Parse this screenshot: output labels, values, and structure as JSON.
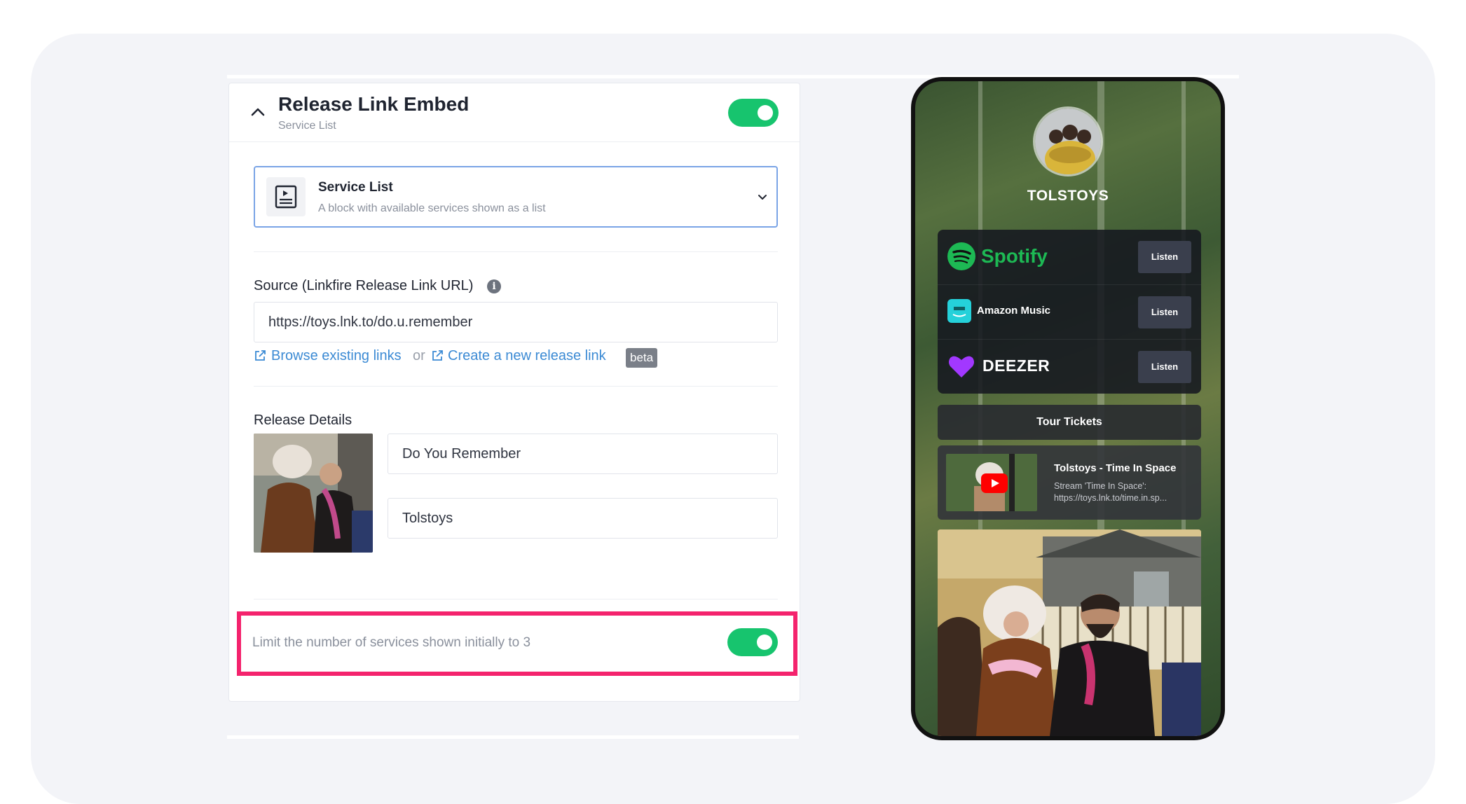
{
  "panel": {
    "title": "Release Link Embed",
    "subtitle": "Service List",
    "enabled": true
  },
  "block_select": {
    "title": "Service List",
    "description": "A block with available services shown as a list",
    "icon": "player-list-icon"
  },
  "source": {
    "label": "Source (Linkfire Release Link URL)",
    "value": "https://toys.lnk.to/do.u.remember",
    "browse_link": "Browse existing links",
    "or_text": "or",
    "create_link": "Create a new release link",
    "badge": "beta"
  },
  "release": {
    "label": "Release Details",
    "title": "Do You Remember",
    "artist": "Tolstoys"
  },
  "limit": {
    "text": "Limit the number of services shown initially to 3",
    "enabled": true
  },
  "preview": {
    "artist": "TOLSTOYS",
    "services": [
      {
        "name": "Spotify",
        "action": "Listen",
        "color": "#1db954"
      },
      {
        "name": "Amazon Music",
        "action": "Listen",
        "color": "#25d1da"
      },
      {
        "name": "DEEZER",
        "action": "Listen",
        "color": "#a238ff"
      }
    ],
    "tour_label": "Tour Tickets",
    "video": {
      "title": "Tolstoys - Time In Space",
      "line1": "Stream 'Time In Space':",
      "line2": "https://toys.lnk.to/time.in.sp..."
    }
  },
  "colors": {
    "toggle_on": "#17c46e",
    "highlight": "#f4236d",
    "link": "#3b8ad4"
  }
}
